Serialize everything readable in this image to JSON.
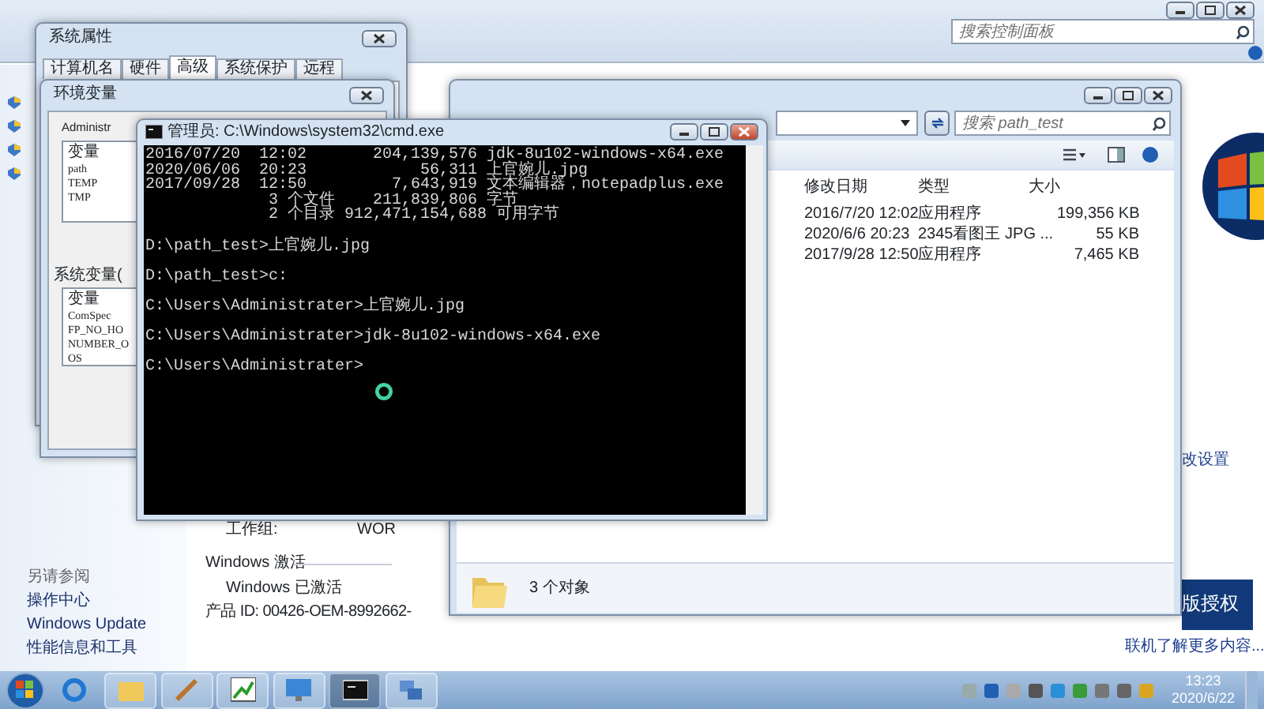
{
  "control_panel": {
    "search": {
      "placeholder": "搜索控制面板"
    },
    "see_also": {
      "title": "另请参阅",
      "links": [
        "操作中心",
        "Windows Update",
        "性能信息和工具"
      ]
    },
    "workgroup": {
      "label": "工作组:",
      "value": "WOR"
    },
    "activation": {
      "heading": "Windows 激活",
      "status": "Windows 已激活",
      "product_id": "产品 ID: 00426-OEM-8992662-"
    },
    "change_settings_link": "改设置",
    "banner_text": "版授权",
    "learn_more_link": "联机了解更多内容..."
  },
  "system_properties": {
    "title": "系统属性",
    "tabs": [
      {
        "label": "计算机名",
        "selected": false
      },
      {
        "label": "硬件",
        "selected": false
      },
      {
        "label": "高级",
        "selected": true
      },
      {
        "label": "系统保护",
        "selected": false
      },
      {
        "label": "远程",
        "selected": false
      }
    ]
  },
  "environment_variables": {
    "title": "环境变量",
    "user_label": "Administr",
    "user_vars": {
      "header": "变量",
      "rows": [
        "path",
        "TEMP",
        "TMP"
      ]
    },
    "system_label": "系统变量(",
    "system_vars": {
      "header": "变量",
      "rows": [
        "ComSpec",
        "FP_NO_HO",
        "NUMBER_O",
        "OS"
      ]
    }
  },
  "explorer": {
    "search": {
      "placeholder": "搜索 path_test"
    },
    "columns": [
      "修改日期",
      "类型",
      "大小"
    ],
    "rows": [
      {
        "date": "2016/7/20 12:02",
        "type": "应用程序",
        "size": "199,356 KB"
      },
      {
        "date": "2020/6/6 20:23",
        "type": "2345看图王 JPG ...",
        "size": "55 KB"
      },
      {
        "date": "2017/9/28 12:50",
        "type": "应用程序",
        "size": "7,465 KB"
      }
    ],
    "status": "3 个对象"
  },
  "cmd": {
    "title": "管理员: C:\\Windows\\system32\\cmd.exe",
    "blocks": [
      [
        "2016/07/20  12:02       204,139,576 jdk-8u102-windows-x64.exe",
        "2020/06/06  20:23            56,311 上官婉儿.jpg",
        "2017/09/28  12:50         7,643,919 文本编辑器，notepadplus.exe",
        "             3 个文件    211,839,806 字节",
        "             2 个目录 912,471,154,688 可用字节"
      ],
      [
        "D:\\path_test>上官婉儿.jpg"
      ],
      [
        "D:\\path_test>c:"
      ],
      [
        "C:\\Users\\Administrater>上官婉儿.jpg"
      ],
      [
        "C:\\Users\\Administrater>jdk-8u102-windows-x64.exe"
      ],
      [
        "C:\\Users\\Administrater>"
      ]
    ]
  },
  "taskbar": {
    "clock": {
      "time": "13:23",
      "date": "2020/6/22"
    }
  }
}
